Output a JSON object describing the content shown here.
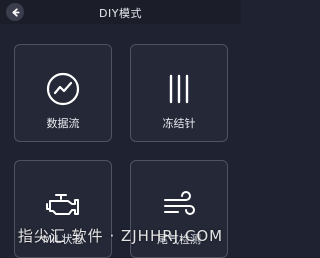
{
  "header": {
    "title": "DIY模式"
  },
  "tiles": [
    {
      "label": "数据流",
      "icon": "chart-trend-icon"
    },
    {
      "label": "冻结针",
      "icon": "freeze-frame-icon"
    },
    {
      "label": "MIL状态",
      "icon": "engine-icon"
    },
    {
      "label": "尾气检测",
      "icon": "wind-icon"
    }
  ],
  "watermark": "指尖汇 软件 · ZJHHRJ.COM",
  "colors": {
    "background": "#1f2230",
    "tile_border": "#4e5262",
    "text": "#e8eaf0"
  }
}
